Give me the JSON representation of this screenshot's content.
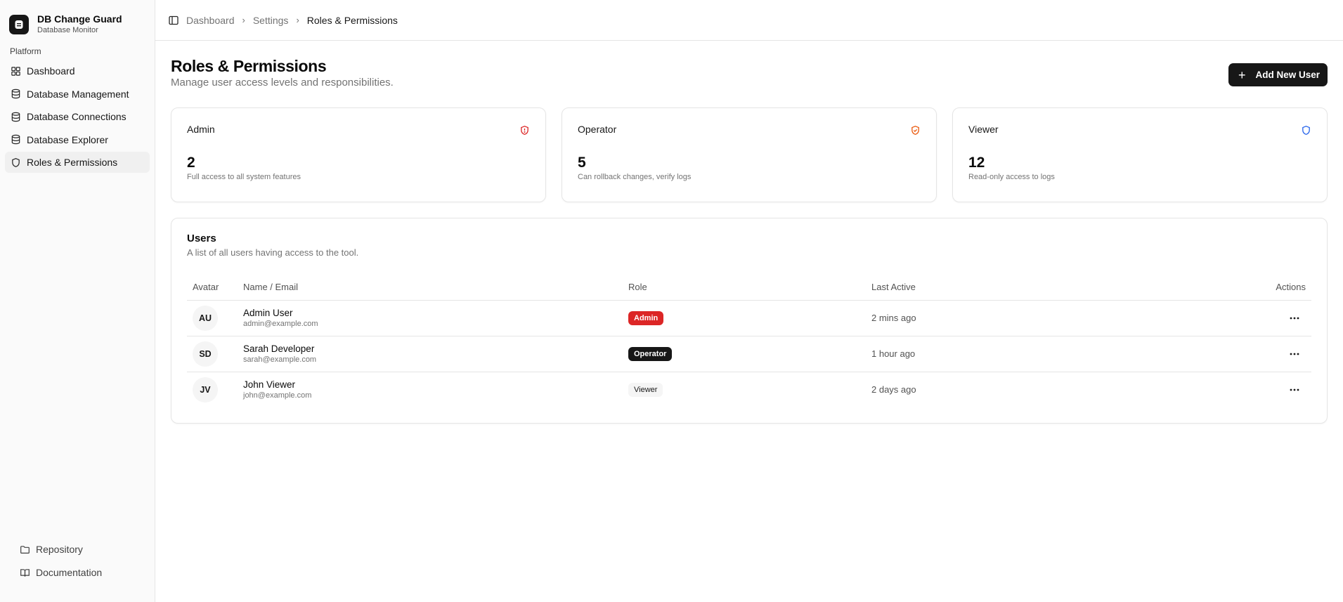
{
  "brand": {
    "name": "DB Change Guard",
    "subtitle": "Database Monitor"
  },
  "sidebar": {
    "group_label": "Platform",
    "items": [
      {
        "label": "Dashboard",
        "icon": "dashboard-grid-icon"
      },
      {
        "label": "Database Management",
        "icon": "database-icon"
      },
      {
        "label": "Database Connections",
        "icon": "database-icon"
      },
      {
        "label": "Database Explorer",
        "icon": "database-icon"
      },
      {
        "label": "Roles & Permissions",
        "icon": "shield-icon",
        "active": true
      }
    ],
    "bottom_items": [
      {
        "label": "Repository",
        "icon": "folder-icon"
      },
      {
        "label": "Documentation",
        "icon": "book-icon"
      }
    ]
  },
  "breadcrumb": [
    "Dashboard",
    "Settings",
    "Roles & Permissions"
  ],
  "page": {
    "title": "Roles & Permissions",
    "subtitle": "Manage user access levels and responsibilities.",
    "add_button": "Add New User"
  },
  "role_cards": [
    {
      "title": "Admin",
      "count": "2",
      "description": "Full access to all system features",
      "icon": "shield-alert-icon",
      "color": "#dc2626"
    },
    {
      "title": "Operator",
      "count": "5",
      "description": "Can rollback changes, verify logs",
      "icon": "shield-check-icon",
      "color": "#ea580c"
    },
    {
      "title": "Viewer",
      "count": "12",
      "description": "Read-only access to logs",
      "icon": "shield-icon",
      "color": "#2563eb"
    }
  ],
  "users": {
    "title": "Users",
    "subtitle": "A list of all users having access to the tool.",
    "columns": [
      "Avatar",
      "Name / Email",
      "Role",
      "Last Active",
      "Actions"
    ],
    "rows": [
      {
        "initials": "AU",
        "name": "Admin User",
        "email": "admin@example.com",
        "role": "Admin",
        "last_active": "2 mins ago"
      },
      {
        "initials": "SD",
        "name": "Sarah Developer",
        "email": "sarah@example.com",
        "role": "Operator",
        "last_active": "1 hour ago"
      },
      {
        "initials": "JV",
        "name": "John Viewer",
        "email": "john@example.com",
        "role": "Viewer",
        "last_active": "2 days ago"
      }
    ]
  },
  "colors": {
    "primary": "#171717",
    "admin": "#dc2626",
    "operator": "#ea580c",
    "viewer": "#2563eb"
  }
}
